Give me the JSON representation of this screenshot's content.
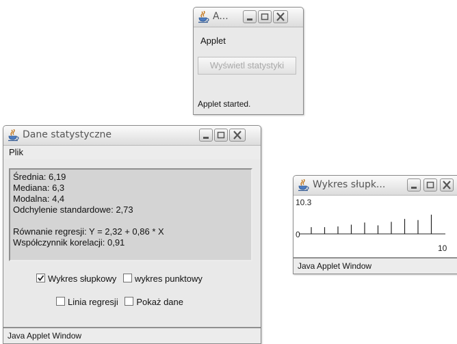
{
  "applet_window": {
    "title": "A...",
    "menu_label": "Applet",
    "button_label": "Wyświetl statystyki",
    "status": "Applet started."
  },
  "stats_window": {
    "title": "Dane statystyczne",
    "menu": [
      "Plik"
    ],
    "stats_lines": [
      "Średnia: 6,19",
      "Mediana: 6,3",
      "Modalna: 4,4",
      "Odchylenie standardowe: 2,73",
      "",
      "Równanie regresji: Y = 2,32 + 0,86 * X",
      "Współczynnik korelacji: 0,91"
    ],
    "checkboxes": {
      "bar_chart": {
        "label": "Wykres słupkowy",
        "checked": true
      },
      "scatter_chart": {
        "label": "wykres punktowy",
        "checked": false
      },
      "regression_line": {
        "label": "Linia regresji",
        "checked": false
      },
      "show_data": {
        "label": "Pokaż dane",
        "checked": false
      }
    },
    "status": "Java Applet Window"
  },
  "chart_window": {
    "title": "Wykres słupk...",
    "status": "Java Applet Window"
  },
  "chart_data": {
    "type": "bar",
    "ymax_label": "10.3",
    "ymin_label": "0",
    "xmax_label": "10",
    "ylim": [
      0,
      10.3
    ],
    "values": [
      1.9,
      1.9,
      2.1,
      2.6,
      3.2,
      2.4,
      3.4,
      4.2,
      3.9,
      5.4
    ]
  },
  "icons": {
    "app": "java-coffee-cup-icon",
    "minimize": "minimize-icon",
    "maximize": "maximize-icon",
    "close": "close-icon"
  }
}
